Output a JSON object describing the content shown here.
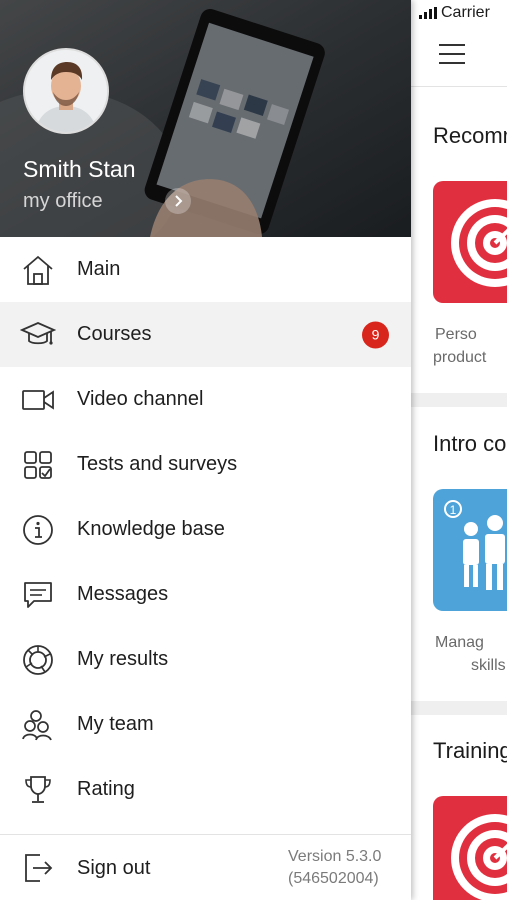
{
  "status_bar": {
    "carrier": "Carrier"
  },
  "profile": {
    "name": "Smith Stan",
    "subtitle": "my office"
  },
  "menu": {
    "items": [
      {
        "label": "Main",
        "icon": "home-icon"
      },
      {
        "label": "Courses",
        "icon": "graduation-cap-icon",
        "badge": "9",
        "active": true
      },
      {
        "label": "Video channel",
        "icon": "video-camera-icon"
      },
      {
        "label": "Tests and surveys",
        "icon": "tests-grid-icon"
      },
      {
        "label": "Knowledge base",
        "icon": "info-icon"
      },
      {
        "label": "Messages",
        "icon": "message-icon"
      },
      {
        "label": "My results",
        "icon": "results-icon"
      },
      {
        "label": "My team",
        "icon": "team-icon"
      },
      {
        "label": "Rating",
        "icon": "trophy-icon"
      }
    ]
  },
  "footer": {
    "signout_label": "Sign out",
    "version": "Version 5.3.0",
    "build": "(546502004)"
  },
  "main_content": {
    "sections": [
      {
        "title": "Recomm",
        "card_caption_1": "Perso",
        "card_caption_2": "product",
        "card_icon": "target-icon"
      },
      {
        "title": "Intro co",
        "card_caption_1": "Manag",
        "card_caption_2": "skills",
        "card_icon": "people-icon",
        "card_badge": "1"
      },
      {
        "title": "Training",
        "card_icon": "target-icon"
      }
    ]
  },
  "colors": {
    "badge": "#d9261c",
    "target_card": "#e0303f",
    "people_card": "#4ea3d8",
    "active_row": "#f2f2f2"
  }
}
